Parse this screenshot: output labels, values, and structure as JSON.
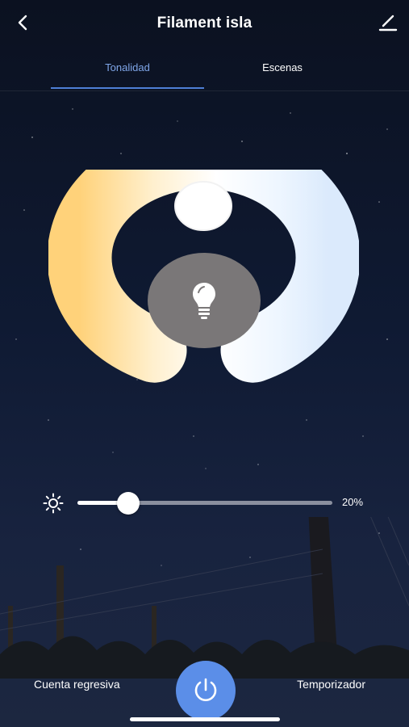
{
  "header": {
    "title": "Filament isla",
    "back_icon": "chevron-left-icon",
    "edit_icon": "pencil-icon"
  },
  "tabs": [
    {
      "label": "Tonalidad",
      "active": true
    },
    {
      "label": "Escenas",
      "active": false
    }
  ],
  "colors": {
    "accent": "#5b8ee8",
    "active_tab": "#7fa6e8",
    "warm": "#ffd27a",
    "cool": "#e3f0ff",
    "center_button": "#7a7778"
  },
  "dial": {
    "center_icon": "lightbulb-icon",
    "scale_start": "warm",
    "scale_end": "cool"
  },
  "brightness": {
    "icon": "sun-icon",
    "value": 20,
    "label": "20%"
  },
  "bottom_bar": {
    "left_label": "Cuenta regresiva",
    "right_label": "Temporizador",
    "power_icon": "power-icon"
  }
}
